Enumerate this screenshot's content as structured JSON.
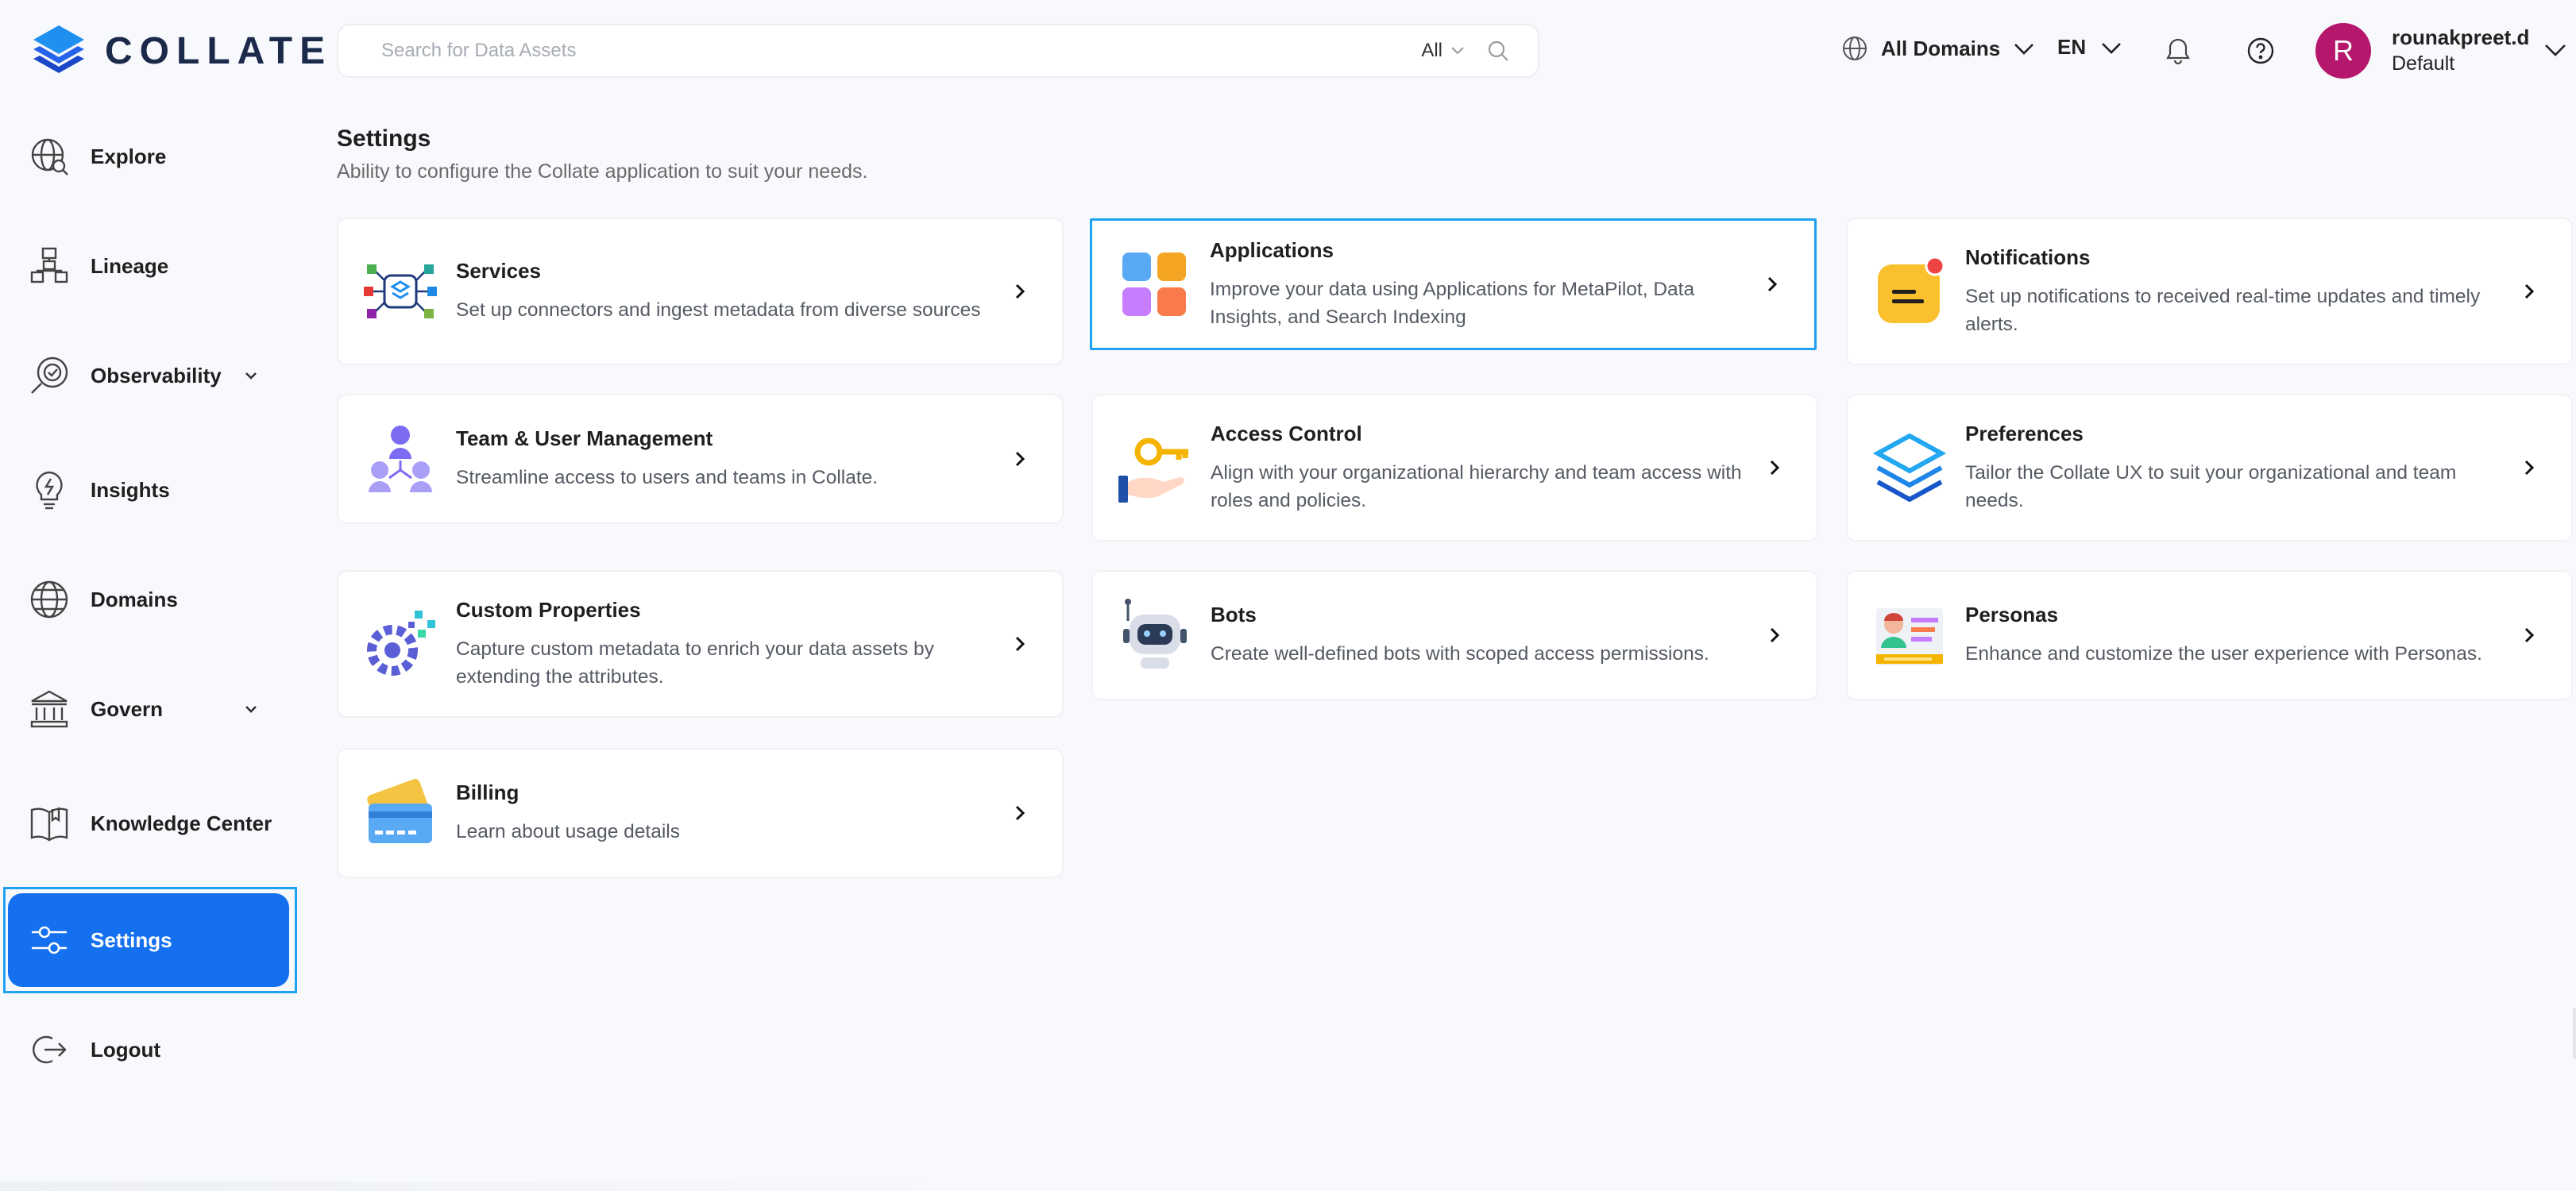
{
  "logo": {
    "text": "COLLATE"
  },
  "sidebar": {
    "items": [
      {
        "label": "Explore",
        "icon": "explore-globe-icon"
      },
      {
        "label": "Lineage",
        "icon": "lineage-icon"
      },
      {
        "label": "Observability",
        "icon": "observability-icon",
        "expandable": true
      },
      {
        "label": "Insights",
        "icon": "insights-bulb-icon"
      },
      {
        "label": "Domains",
        "icon": "domains-globe-icon"
      },
      {
        "label": "Govern",
        "icon": "govern-bank-icon",
        "expandable": true
      },
      {
        "label": "Knowledge Center",
        "icon": "knowledge-book-icon"
      },
      {
        "label": "Settings",
        "icon": "settings-sliders-icon",
        "active": true
      },
      {
        "label": "Logout",
        "icon": "logout-icon"
      }
    ]
  },
  "topbar": {
    "search_placeholder": "Search for Data Assets",
    "search_filter": "All",
    "domains_label": "All Domains",
    "language": "EN",
    "user": {
      "initial": "R",
      "name": "rounakpreet.d",
      "role": "Default",
      "avatar_color": "#b5176c"
    }
  },
  "page": {
    "title": "Settings",
    "subtitle": "Ability to configure the Collate application to suit your needs."
  },
  "cards": [
    {
      "title": "Services",
      "description": "Set up connectors and ingest metadata from diverse sources",
      "icon": "services-hub-icon"
    },
    {
      "title": "Applications",
      "description": "Improve your data using Applications for MetaPilot, Data Insights, and Search Indexing",
      "icon": "applications-grid-icon",
      "selected": true
    },
    {
      "title": "Notifications",
      "description": "Set up notifications to received real-time updates and timely alerts.",
      "icon": "notification-message-icon"
    },
    {
      "title": "Team & User Management",
      "description": "Streamline access to users and teams in Collate.",
      "icon": "team-users-icon"
    },
    {
      "title": "Access Control",
      "description": "Align with your organizational hierarchy and team access with roles and policies.",
      "icon": "access-key-icon"
    },
    {
      "title": "Preferences",
      "description": "Tailor the Collate UX to suit your organizational and team needs.",
      "icon": "preferences-layers-icon"
    },
    {
      "title": "Custom Properties",
      "description": "Capture custom metadata to enrich your data assets by extending the attributes.",
      "icon": "custom-properties-gear-icon"
    },
    {
      "title": "Bots",
      "description": "Create well-defined bots with scoped access permissions.",
      "icon": "bot-robot-icon"
    },
    {
      "title": "Personas",
      "description": "Enhance and customize the user experience with Personas.",
      "icon": "personas-profile-icon"
    },
    {
      "title": "Billing",
      "description": "Learn about usage details",
      "icon": "billing-card-icon"
    }
  ],
  "colors": {
    "accent": "#1470ef",
    "selected_outline": "#1ea1f2",
    "background": "#f8f9fc"
  }
}
